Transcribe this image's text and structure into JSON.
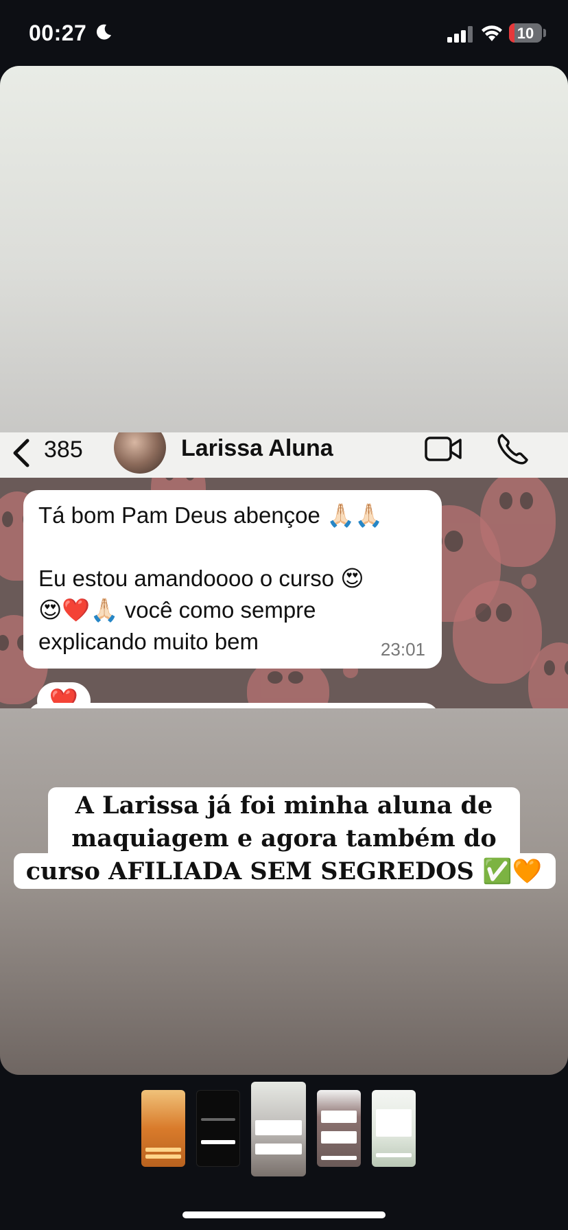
{
  "status_bar": {
    "time": "00:27",
    "battery": "10",
    "icons": [
      "moon-icon",
      "signal-icon",
      "wifi-icon",
      "battery-icon"
    ]
  },
  "chat": {
    "back_count": "385",
    "contact_name": "Larissa Aluna",
    "message": {
      "line1": "Tá bom Pam Deus abençoe 🙏🏻🙏🏻",
      "line2": "Eu estou amandoooo o curso 😍",
      "line3": "😍❤️🙏🏻 você como sempre",
      "line4": "explicando muito bem",
      "time": "23:01"
    },
    "reaction": "❤️",
    "header_icons": [
      "back-chevron-icon",
      "video-call-icon",
      "phone-icon"
    ]
  },
  "caption": {
    "line1": "A Larissa já foi minha aluna de",
    "line2": "maquiagem e agora também do",
    "line3": "curso AFILIADA SEM SEGREDOS ✅🧡"
  },
  "colors": {
    "background": "#0d0f14",
    "chat_wallpaper": "#6a5a58",
    "owl_pattern": "#b77272",
    "battery_low": "#e5393b"
  }
}
